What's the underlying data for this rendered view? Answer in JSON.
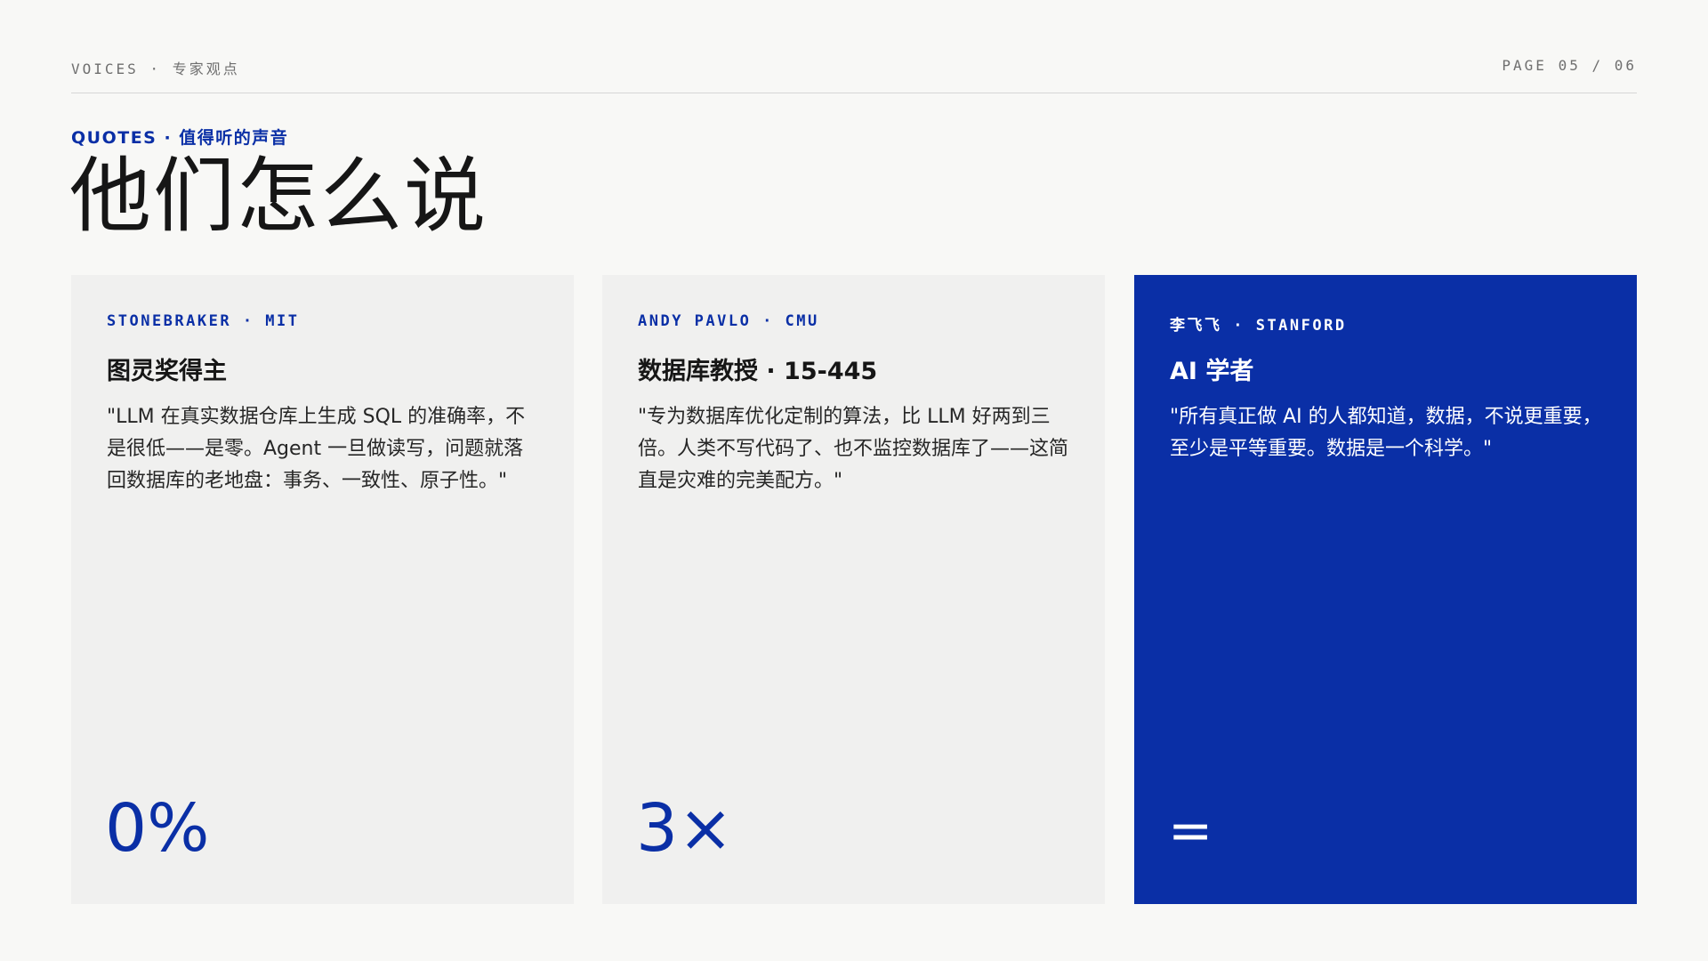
{
  "header": {
    "section": "VOICES · 专家观点",
    "page": "PAGE 05 / 06"
  },
  "kicker": "QUOTES · 值得听的声音",
  "title": "他们怎么说",
  "cards": [
    {
      "tag": "STONEBRAKER · MIT",
      "role": "图灵奖得主",
      "quote": "\"LLM 在真实数据仓库上生成 SQL 的准确率，不是很低——是零。Agent 一旦做读写，问题就落回数据库的老地盘：事务、一致性、原子性。\"",
      "stat": "0%"
    },
    {
      "tag": "ANDY PAVLO · CMU",
      "role": "数据库教授 · 15-445",
      "quote": "\"专为数据库优化定制的算法，比 LLM 好两到三倍。人类不写代码了、也不监控数据库了——这简直是灾难的完美配方。\"",
      "stat": "3×"
    },
    {
      "tag": "李飞飞 · STANFORD",
      "role": "AI 学者",
      "quote": "\"所有真正做 AI 的人都知道，数据，不说更重要，至少是平等重要。数据是一个科学。\"",
      "stat": "="
    }
  ],
  "colors": {
    "accent": "#0a2fa6",
    "background": "#f8f8f6",
    "card": "#f0f0ef"
  }
}
